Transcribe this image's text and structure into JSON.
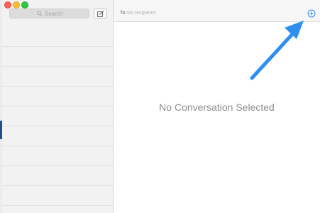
{
  "sidebar": {
    "search": {
      "placeholder": "Search",
      "icon": "search-icon"
    },
    "compose": {
      "icon": "compose-icon"
    }
  },
  "main": {
    "to_label": "To:",
    "to_placeholder": "No recipients",
    "add_icon": "plus-circle-icon",
    "empty_message": "No Conversation Selected"
  },
  "annotation": {
    "color": "#2f8ef2"
  }
}
